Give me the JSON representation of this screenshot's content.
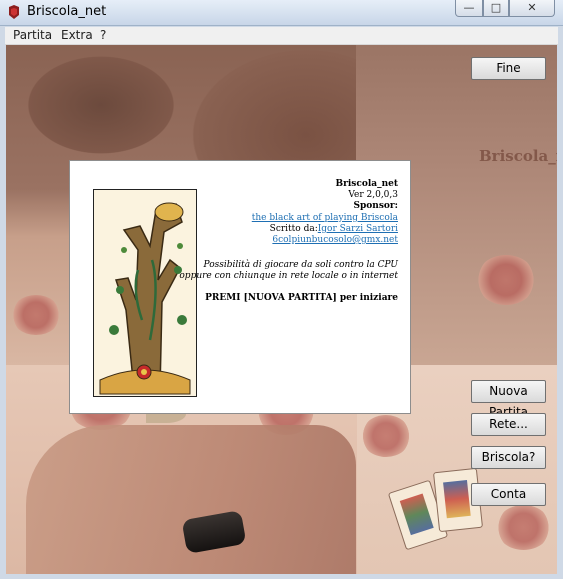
{
  "window": {
    "title": "Briscola_net"
  },
  "menu": [
    "Partita",
    "Extra",
    "?"
  ],
  "watermark": "Briscola_n",
  "buttons": {
    "fine": "Fine",
    "nuova_partita": "Nuova Partita",
    "rete": "Rete...",
    "briscola": "Briscola?",
    "conta": "Conta"
  },
  "dialog": {
    "app_name": "Briscola_net",
    "version": "Ver 2,0,0,3",
    "sponsor_label": "Sponsor:",
    "sponsor_link": "the black art of playing Briscola",
    "author_prefix": "Scritto da:",
    "author_name": "Igor Sarzi Sartori",
    "email": "6colpiunbucosolo@gmx.net",
    "desc_line1": "Possibilità di giocare da soli contro la CPU",
    "desc_line2": "oppure con chiunque in rete locale o in internet",
    "instruction": "PREMI [NUOVA PARTITA] per iniziare"
  }
}
